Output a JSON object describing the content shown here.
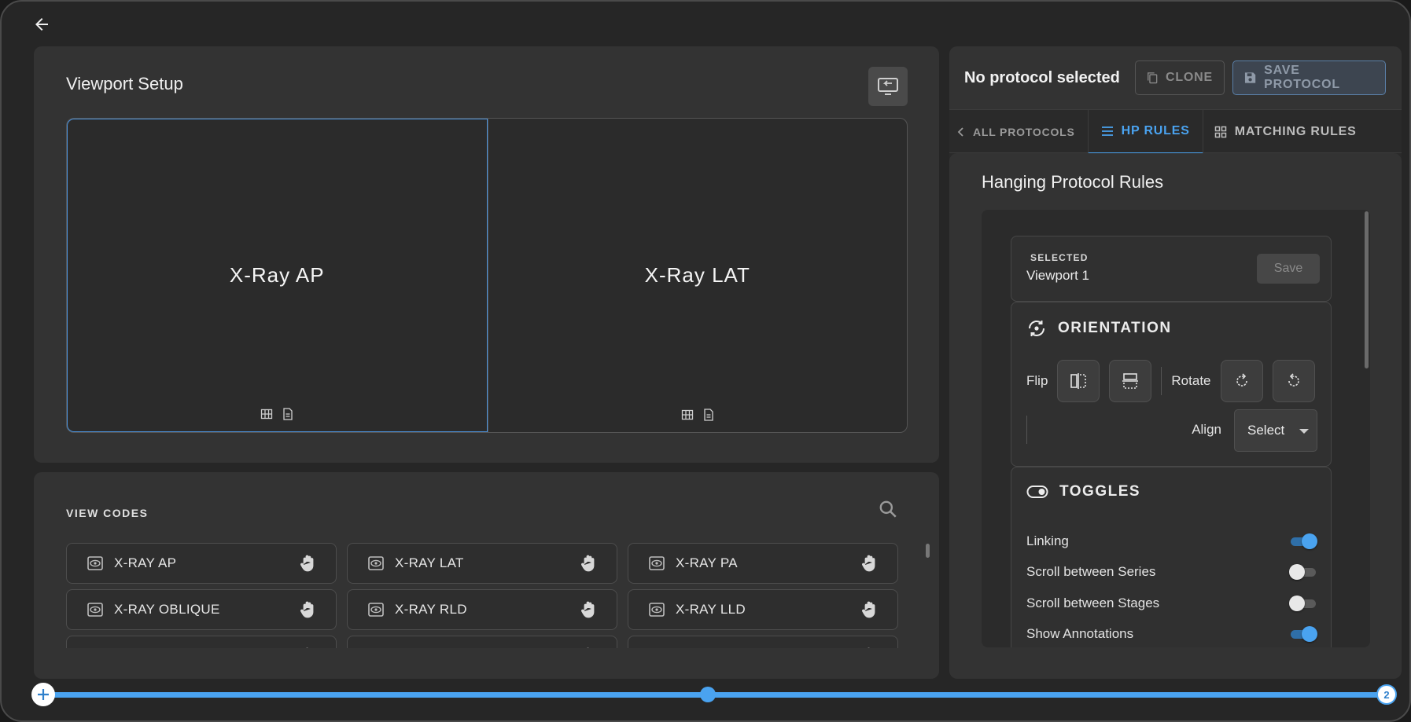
{
  "viewport_setup": {
    "title": "Viewport Setup",
    "viewports": [
      {
        "label": "X-Ray AP",
        "selected": true
      },
      {
        "label": "X-Ray LAT",
        "selected": false
      }
    ]
  },
  "view_codes": {
    "heading": "VIEW CODES",
    "items": [
      "X-RAY AP",
      "X-RAY LAT",
      "X-RAY PA",
      "X-RAY OBLIQUE",
      "X-RAY RLD",
      "X-RAY LLD",
      "",
      "",
      ""
    ]
  },
  "protocol_header": {
    "title": "No protocol selected",
    "clone_label": "CLONE",
    "save_protocol_label": "SAVE PROTOCOL"
  },
  "tabs": {
    "all_protocols": "ALL PROTOCOLS",
    "hp_rules": "HP RULES",
    "matching_rules": "MATCHING RULES",
    "active": "hp_rules"
  },
  "rules": {
    "title": "Hanging Protocol Rules",
    "selected": {
      "label": "SELECTED",
      "value": "Viewport 1",
      "save_label": "Save"
    },
    "orientation": {
      "title": "ORIENTATION",
      "flip_label": "Flip",
      "rotate_label": "Rotate",
      "align_label": "Align",
      "align_value": "Select"
    },
    "toggles": {
      "title": "TOGGLES",
      "items": [
        {
          "label": "Linking",
          "on": true
        },
        {
          "label": "Scroll between Series",
          "on": false
        },
        {
          "label": "Scroll between Stages",
          "on": false
        },
        {
          "label": "Show Annotations",
          "on": true
        }
      ]
    }
  },
  "stage_slider": {
    "end_label": "2"
  },
  "colors": {
    "accent": "#4aa3f0",
    "panel": "#333333",
    "background": "#262626"
  }
}
